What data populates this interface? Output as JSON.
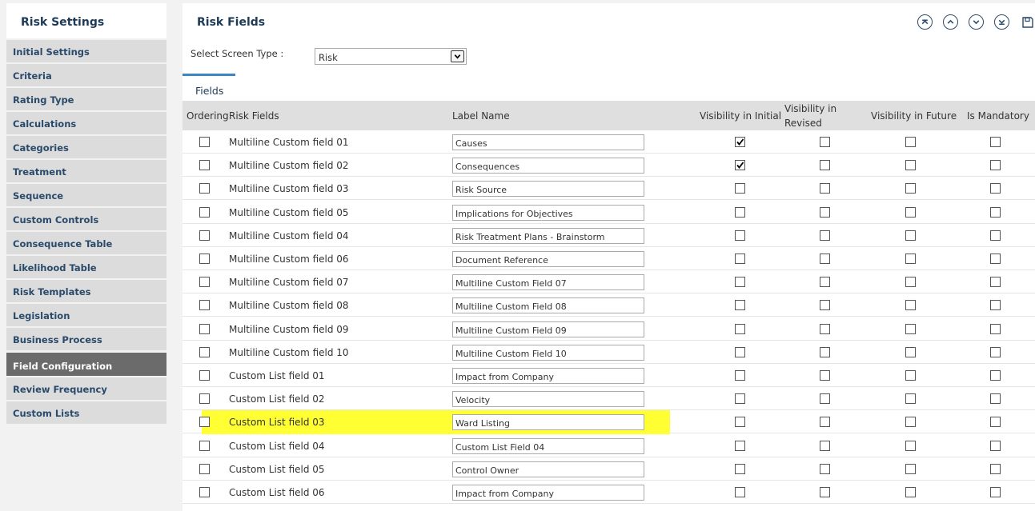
{
  "sidebar": {
    "title": "Risk Settings",
    "items": [
      {
        "label": "Initial Settings",
        "active": false
      },
      {
        "label": "Criteria",
        "active": false
      },
      {
        "label": "Rating Type",
        "active": false
      },
      {
        "label": "Calculations",
        "active": false
      },
      {
        "label": "Categories",
        "active": false
      },
      {
        "label": "Treatment",
        "active": false
      },
      {
        "label": "Sequence",
        "active": false
      },
      {
        "label": "Custom Controls",
        "active": false
      },
      {
        "label": "Consequence Table",
        "active": false
      },
      {
        "label": "Likelihood Table",
        "active": false
      },
      {
        "label": "Risk Templates",
        "active": false
      },
      {
        "label": "Legislation",
        "active": false
      },
      {
        "label": "Business Process",
        "active": false
      },
      {
        "label": "Field Configuration",
        "active": true
      },
      {
        "label": "Review Frequency",
        "active": false
      },
      {
        "label": "Custom Lists",
        "active": false
      }
    ]
  },
  "main": {
    "title": "Risk Fields",
    "toolbar": [
      "move-top-icon",
      "move-up-icon",
      "move-down-icon",
      "move-bottom-icon",
      "save-icon"
    ],
    "screen_type_label": "Select Screen Type :",
    "screen_type_value": "Risk",
    "tab_label": "Fields"
  },
  "table": {
    "headers": {
      "ordering": "Ordering",
      "risk_fields": "Risk Fields",
      "label_name": "Label Name",
      "vis_initial": "Visibility in Initial",
      "vis_revised_1": "Visibility in",
      "vis_revised_2": "Revised",
      "vis_future": "Visibility in Future",
      "mandatory": "Is Mandatory"
    },
    "rows": [
      {
        "field": "Multiline Custom field 01",
        "label": "Causes",
        "initial": true,
        "revised": false,
        "future": false,
        "mandatory": false,
        "highlight": false
      },
      {
        "field": "Multiline Custom field 02",
        "label": "Consequences",
        "initial": true,
        "revised": false,
        "future": false,
        "mandatory": false,
        "highlight": false
      },
      {
        "field": "Multiline Custom field 03",
        "label": "Risk Source",
        "initial": false,
        "revised": false,
        "future": false,
        "mandatory": false,
        "highlight": false
      },
      {
        "field": "Multiline Custom field 05",
        "label": "Implications for Objectives",
        "initial": false,
        "revised": false,
        "future": false,
        "mandatory": false,
        "highlight": false
      },
      {
        "field": "Multiline Custom field 04",
        "label": "Risk Treatment Plans - Brainstorm",
        "initial": false,
        "revised": false,
        "future": false,
        "mandatory": false,
        "highlight": false
      },
      {
        "field": "Multiline Custom field 06",
        "label": "Document Reference",
        "initial": false,
        "revised": false,
        "future": false,
        "mandatory": false,
        "highlight": false
      },
      {
        "field": "Multiline Custom field 07",
        "label": "Multiline Custom Field 07",
        "initial": false,
        "revised": false,
        "future": false,
        "mandatory": false,
        "highlight": false
      },
      {
        "field": "Multiline Custom field 08",
        "label": "Multiline Custom Field 08",
        "initial": false,
        "revised": false,
        "future": false,
        "mandatory": false,
        "highlight": false
      },
      {
        "field": "Multiline Custom field 09",
        "label": "Multiline Custom Field 09",
        "initial": false,
        "revised": false,
        "future": false,
        "mandatory": false,
        "highlight": false
      },
      {
        "field": "Multiline Custom field 10",
        "label": "Multiline Custom Field 10",
        "initial": false,
        "revised": false,
        "future": false,
        "mandatory": false,
        "highlight": false
      },
      {
        "field": "Custom List field 01",
        "label": "Impact from Company",
        "initial": false,
        "revised": false,
        "future": false,
        "mandatory": false,
        "highlight": false
      },
      {
        "field": "Custom List field 02",
        "label": "Velocity",
        "initial": false,
        "revised": false,
        "future": false,
        "mandatory": false,
        "highlight": false
      },
      {
        "field": "Custom List field 03",
        "label": "Ward Listing",
        "initial": false,
        "revised": false,
        "future": false,
        "mandatory": false,
        "highlight": true
      },
      {
        "field": "Custom List field 04",
        "label": "Custom List Field 04",
        "initial": false,
        "revised": false,
        "future": false,
        "mandatory": false,
        "highlight": false
      },
      {
        "field": "Custom List field 05",
        "label": "Control Owner",
        "initial": false,
        "revised": false,
        "future": false,
        "mandatory": false,
        "highlight": false
      },
      {
        "field": "Custom List field 06",
        "label": "Impact from Company",
        "initial": false,
        "revised": false,
        "future": false,
        "mandatory": false,
        "highlight": false
      }
    ]
  },
  "colors": {
    "highlight": "#ffff33",
    "accent": "#3b86c6",
    "active_nav": "#6b6b6b"
  }
}
